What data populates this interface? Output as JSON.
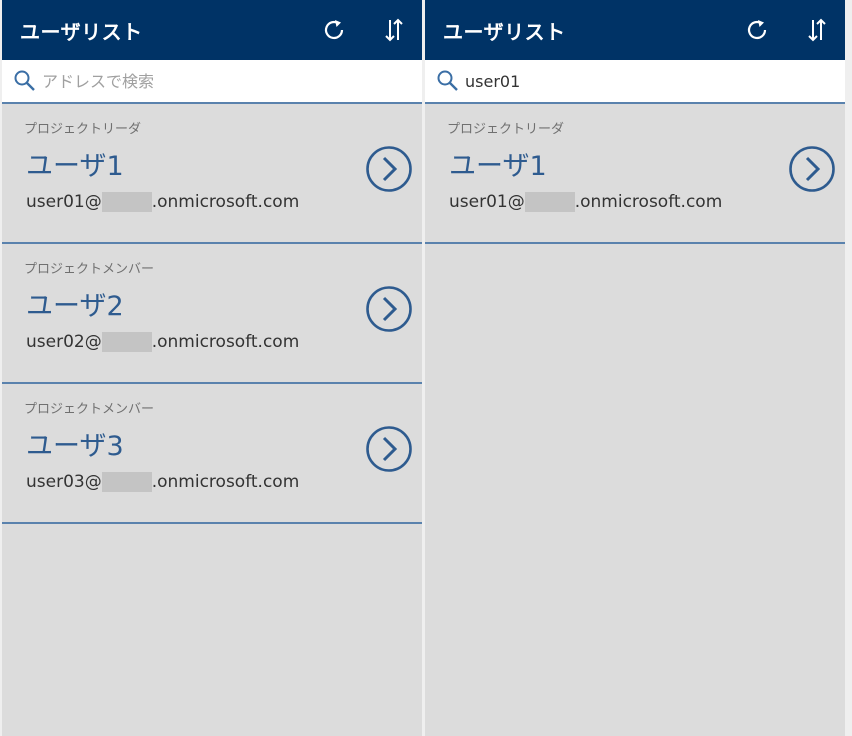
{
  "colors": {
    "header_bg": "#003366",
    "accent": "#2e5b8f",
    "list_bg": "#dcdcdc",
    "divider": "#5a82ad"
  },
  "left": {
    "title": "ユーザリスト",
    "icons": {
      "refresh": "refresh-icon",
      "sort": "sort-icon",
      "search": "search-icon",
      "detail": "chevron-right-circle-icon"
    },
    "search": {
      "placeholder": "アドレスで検索",
      "value": ""
    },
    "items": [
      {
        "role": "プロジェクトリーダ",
        "name": "ユーザ1",
        "email_user": "user01@",
        "email_domain": ".onmicrosoft.com"
      },
      {
        "role": "プロジェクトメンバー",
        "name": "ユーザ2",
        "email_user": "user02@",
        "email_domain": ".onmicrosoft.com"
      },
      {
        "role": "プロジェクトメンバー",
        "name": "ユーザ3",
        "email_user": "user03@",
        "email_domain": ".onmicrosoft.com"
      }
    ]
  },
  "right": {
    "title": "ユーザリスト",
    "search": {
      "placeholder": "アドレスで検索",
      "value": "user01"
    },
    "items": [
      {
        "role": "プロジェクトリーダ",
        "name": "ユーザ1",
        "email_user": "user01@",
        "email_domain": ".onmicrosoft.com"
      }
    ]
  }
}
